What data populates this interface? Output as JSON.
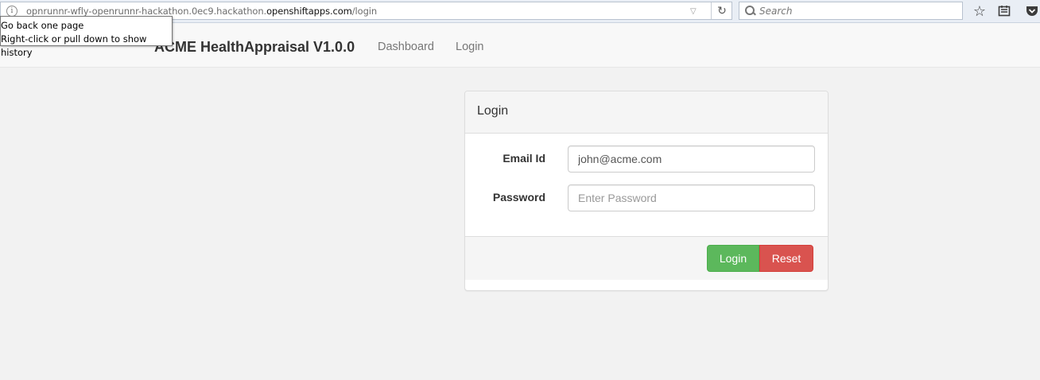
{
  "browser": {
    "url_prefix": "opnrunnr-wfly-openrunnr-hackathon.0ec9.hackathon.",
    "url_domain": "openshiftapps.com",
    "url_path": "/login",
    "search_placeholder": "Search",
    "icons": [
      "info-icon",
      "dropdown-arrow-icon",
      "reload-icon",
      "search-icon",
      "bookmark-star-icon",
      "reading-list-icon",
      "pocket-icon"
    ]
  },
  "tooltip": {
    "line1": "Go back one page",
    "line2": "Right-click or pull down to show history"
  },
  "navbar": {
    "brand": "ACME HealthAppraisal V1.0.0",
    "links": [
      "Dashboard",
      "Login"
    ]
  },
  "login_panel": {
    "title": "Login",
    "email_label": "Email Id",
    "email_value": "john@acme.com",
    "password_label": "Password",
    "password_placeholder": "Enter Password",
    "login_button": "Login",
    "reset_button": "Reset"
  },
  "colors": {
    "login_button": "#5cb85c",
    "reset_button": "#d9534f",
    "background": "#f2f2f2"
  }
}
